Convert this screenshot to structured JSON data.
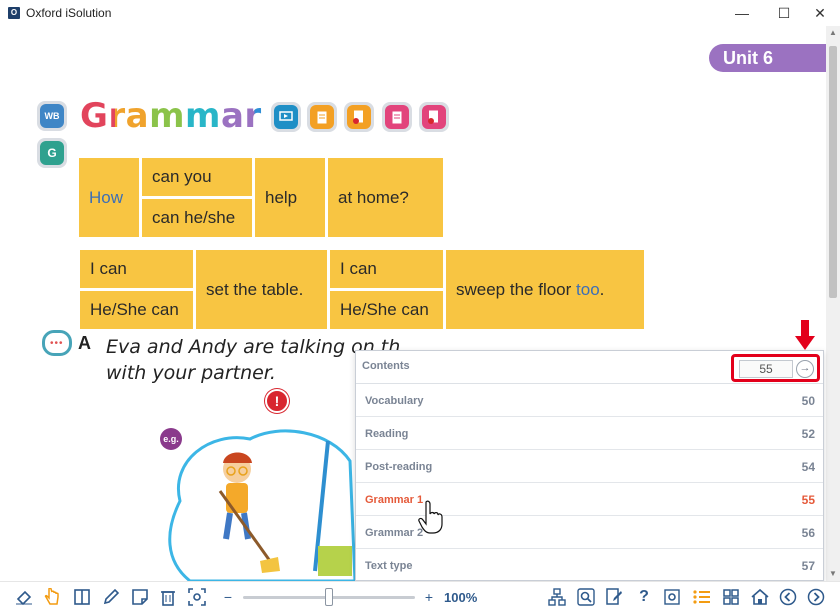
{
  "window": {
    "title": "Oxford iSolution",
    "minimize": "—",
    "maximize": "☐",
    "close": "✕"
  },
  "page": {
    "unit_tab": "Unit 6",
    "title": "Grammar 1",
    "badges": {
      "wb": "WB",
      "g": "G"
    },
    "table1": {
      "how": "How",
      "can_you": "can you",
      "can_heshe": "can he/she",
      "help": "help",
      "at_home": "at home?"
    },
    "table2": {
      "i_can_1": "I can",
      "heshe_can_1": "He/She can",
      "set_table": "set the table.",
      "i_can_2": "I can",
      "heshe_can_2": "He/She can",
      "sweep": "sweep the floor",
      "too": "too",
      "period": "."
    },
    "section": {
      "letter": "A",
      "line1": "Eva and Andy are talking on th",
      "line2": "with your partner.",
      "eg": "e.g."
    }
  },
  "contents_panel": {
    "label": "Contents",
    "page_value": "55",
    "go_icon": "arrow-right-circle-icon",
    "items": [
      {
        "name": "Vocabulary",
        "page": "50",
        "active": false
      },
      {
        "name": "Reading",
        "page": "52",
        "active": false
      },
      {
        "name": "Post-reading",
        "page": "54",
        "active": false
      },
      {
        "name": "Grammar 1",
        "page": "55",
        "active": true
      },
      {
        "name": "Grammar 2",
        "page": "56",
        "active": false
      },
      {
        "name": "Text type",
        "page": "57",
        "active": false
      }
    ]
  },
  "toolbar": {
    "zoom_minus": "−",
    "zoom_plus": "+",
    "zoom_value": "100%",
    "zoom_fraction": 0.5
  },
  "colors": {
    "accent_blue": "#2f5a8c",
    "table_yellow": "#f8c542",
    "unit_purple": "#9b72c1",
    "active_item": "#e55a3a",
    "highlight_red": "#e3001b"
  }
}
